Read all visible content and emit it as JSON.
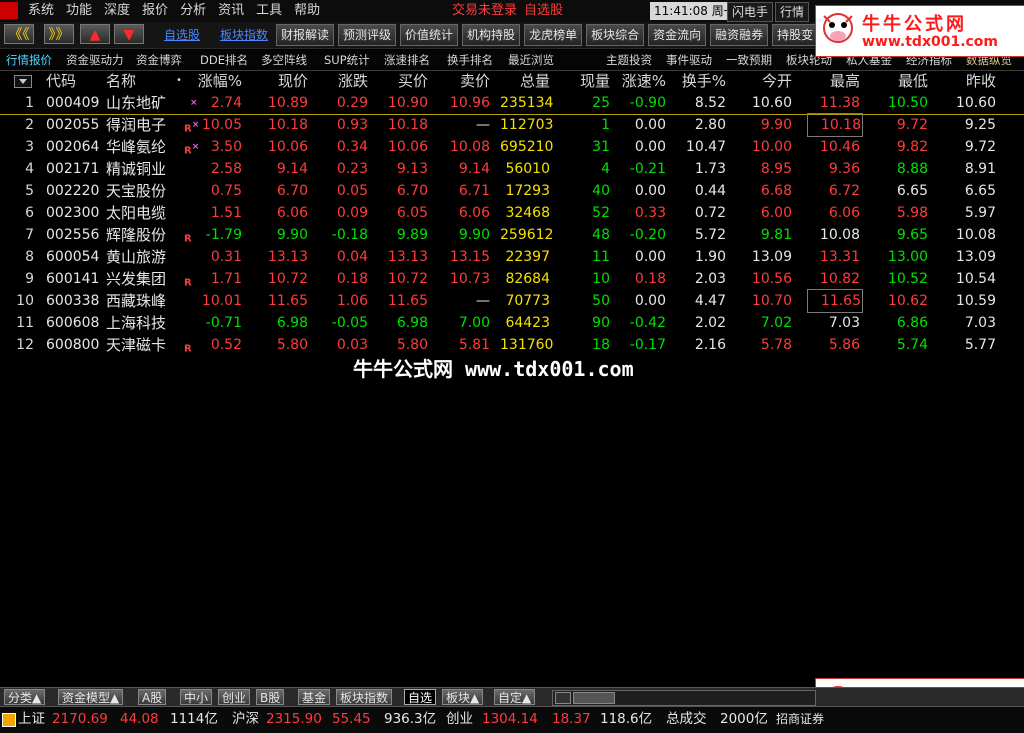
{
  "menubar": {
    "items": [
      "系统",
      "功能",
      "深度",
      "报价",
      "分析",
      "资讯",
      "工具",
      "帮助"
    ],
    "trade_status": "交易未登录",
    "watchlist": "自选股",
    "time": "11:41:08 周一",
    "flash_btn": "闪电手",
    "quote_btn": "行情"
  },
  "toolbar": {
    "back": "《《",
    "forward": "》》",
    "up": "▲",
    "down": "▼",
    "links": [
      "自选股",
      "板块指数"
    ],
    "buttons": [
      "财报解读",
      "预测评级",
      "价值统计",
      "机构持股",
      "龙虎榜单",
      "板块综合",
      "资金流向",
      "融资融券",
      "持股变"
    ]
  },
  "tabs": {
    "left": [
      "行情报价",
      "资金驱动力",
      "资金博弈",
      "DDE排名",
      "多空阵线",
      "SUP统计",
      "涨速排名",
      "换手排名",
      "最近浏览"
    ],
    "right": [
      "主题投资",
      "事件驱动",
      "一致预期",
      "板块轮动",
      "私人基金",
      "经济指标",
      "数据纵览"
    ]
  },
  "columns": [
    "代码",
    "名称",
    "•",
    "涨幅%",
    "现价",
    "涨跌",
    "买价",
    "卖价",
    "总量",
    "现量",
    "涨速%",
    "换手%",
    "今开",
    "最高",
    "最低",
    "昨收"
  ],
  "rows": [
    {
      "idx": "1",
      "code": "000409",
      "name": "山东地矿",
      "mark": "",
      "sup": "×",
      "pct": "2.74",
      "price": "10.89",
      "chg": "0.29",
      "bid": "10.90",
      "ask": "10.96",
      "vol": "235134",
      "cur": "25",
      "speed": "-0.90",
      "turn": "8.52",
      "open": "10.60",
      "high": "11.38",
      "low": "10.50",
      "prev": "10.60"
    },
    {
      "idx": "2",
      "code": "002055",
      "name": "得润电子",
      "mark": "R",
      "sup": "×",
      "pct": "10.05",
      "price": "10.18",
      "chg": "0.93",
      "bid": "10.18",
      "ask": "—",
      "vol": "112703",
      "cur": "1",
      "speed": "0.00",
      "turn": "2.80",
      "open": "9.90",
      "high": "10.18",
      "low": "9.72",
      "prev": "9.25"
    },
    {
      "idx": "3",
      "code": "002064",
      "name": "华峰氨纶",
      "mark": "R",
      "sup": "×",
      "pct": "3.50",
      "price": "10.06",
      "chg": "0.34",
      "bid": "10.06",
      "ask": "10.08",
      "vol": "695210",
      "cur": "31",
      "speed": "0.00",
      "turn": "10.47",
      "open": "10.00",
      "high": "10.46",
      "low": "9.82",
      "prev": "9.72"
    },
    {
      "idx": "4",
      "code": "002171",
      "name": "精诚铜业",
      "mark": "",
      "sup": "",
      "pct": "2.58",
      "price": "9.14",
      "chg": "0.23",
      "bid": "9.13",
      "ask": "9.14",
      "vol": "56010",
      "cur": "4",
      "speed": "-0.21",
      "turn": "1.73",
      "open": "8.95",
      "high": "9.36",
      "low": "8.88",
      "prev": "8.91"
    },
    {
      "idx": "5",
      "code": "002220",
      "name": "天宝股份",
      "mark": "",
      "sup": "",
      "pct": "0.75",
      "price": "6.70",
      "chg": "0.05",
      "bid": "6.70",
      "ask": "6.71",
      "vol": "17293",
      "cur": "40",
      "speed": "0.00",
      "turn": "0.44",
      "open": "6.68",
      "high": "6.72",
      "low": "6.65",
      "prev": "6.65"
    },
    {
      "idx": "6",
      "code": "002300",
      "name": "太阳电缆",
      "mark": "",
      "sup": "",
      "pct": "1.51",
      "price": "6.06",
      "chg": "0.09",
      "bid": "6.05",
      "ask": "6.06",
      "vol": "32468",
      "cur": "52",
      "speed": "0.33",
      "turn": "0.72",
      "open": "6.00",
      "high": "6.06",
      "low": "5.98",
      "prev": "5.97"
    },
    {
      "idx": "7",
      "code": "002556",
      "name": "辉隆股份",
      "mark": "R",
      "sup": "",
      "pct": "-1.79",
      "price": "9.90",
      "chg": "-0.18",
      "bid": "9.89",
      "ask": "9.90",
      "vol": "259612",
      "cur": "48",
      "speed": "-0.20",
      "turn": "5.72",
      "open": "9.81",
      "high": "10.08",
      "low": "9.65",
      "prev": "10.08"
    },
    {
      "idx": "8",
      "code": "600054",
      "name": "黄山旅游",
      "mark": "",
      "sup": "",
      "pct": "0.31",
      "price": "13.13",
      "chg": "0.04",
      "bid": "13.13",
      "ask": "13.15",
      "vol": "22397",
      "cur": "11",
      "speed": "0.00",
      "turn": "1.90",
      "open": "13.09",
      "high": "13.31",
      "low": "13.00",
      "prev": "13.09"
    },
    {
      "idx": "9",
      "code": "600141",
      "name": "兴发集团",
      "mark": "R",
      "sup": "",
      "pct": "1.71",
      "price": "10.72",
      "chg": "0.18",
      "bid": "10.72",
      "ask": "10.73",
      "vol": "82684",
      "cur": "10",
      "speed": "0.18",
      "turn": "2.03",
      "open": "10.56",
      "high": "10.82",
      "low": "10.52",
      "prev": "10.54"
    },
    {
      "idx": "10",
      "code": "600338",
      "name": "西藏珠峰",
      "mark": "",
      "sup": "",
      "pct": "10.01",
      "price": "11.65",
      "chg": "1.06",
      "bid": "11.65",
      "ask": "—",
      "vol": "70773",
      "cur": "50",
      "speed": "0.00",
      "turn": "4.47",
      "open": "10.70",
      "high": "11.65",
      "low": "10.62",
      "prev": "10.59"
    },
    {
      "idx": "11",
      "code": "600608",
      "name": "上海科技",
      "mark": "",
      "sup": "",
      "pct": "-0.71",
      "price": "6.98",
      "chg": "-0.05",
      "bid": "6.98",
      "ask": "7.00",
      "vol": "64423",
      "cur": "90",
      "speed": "-0.42",
      "turn": "2.02",
      "open": "7.02",
      "high": "7.03",
      "low": "6.86",
      "prev": "7.03"
    },
    {
      "idx": "12",
      "code": "600800",
      "name": "天津磁卡",
      "mark": "R",
      "sup": "",
      "pct": "0.52",
      "price": "5.80",
      "chg": "0.03",
      "bid": "5.80",
      "ask": "5.81",
      "vol": "131760",
      "cur": "18",
      "speed": "-0.17",
      "turn": "2.16",
      "open": "5.78",
      "high": "5.86",
      "low": "5.74",
      "prev": "5.77"
    }
  ],
  "watermark": "牛牛公式网 www.tdx001.com",
  "brand": {
    "title": "牛牛公式网",
    "url": "www.tdx001.com"
  },
  "bottom_tabs": [
    "分类▲",
    "资金模型▲",
    "A股",
    "中小",
    "创业",
    "B股",
    "基金",
    "板块指数",
    "自选",
    "板块▲",
    "自定▲"
  ],
  "status": {
    "sh_label": "上证",
    "sh_val": "2170.69",
    "sh_chg": "44.08",
    "sh_amt": "1114亿",
    "hs_label": "沪深",
    "hs_val": "2315.90",
    "hs_chg": "55.45",
    "hs_amt": "936.3亿",
    "cy_label": "创业",
    "cy_val": "1304.14",
    "cy_chg": "18.37",
    "cy_amt": "118.6亿",
    "total_label": "总成交",
    "total_val": "2000亿",
    "broker": "招商证券"
  },
  "colors": {
    "up": "#ff3b3b",
    "down": "#00e000",
    "flat": "#e6e6e6",
    "volume": "#f5e100"
  }
}
